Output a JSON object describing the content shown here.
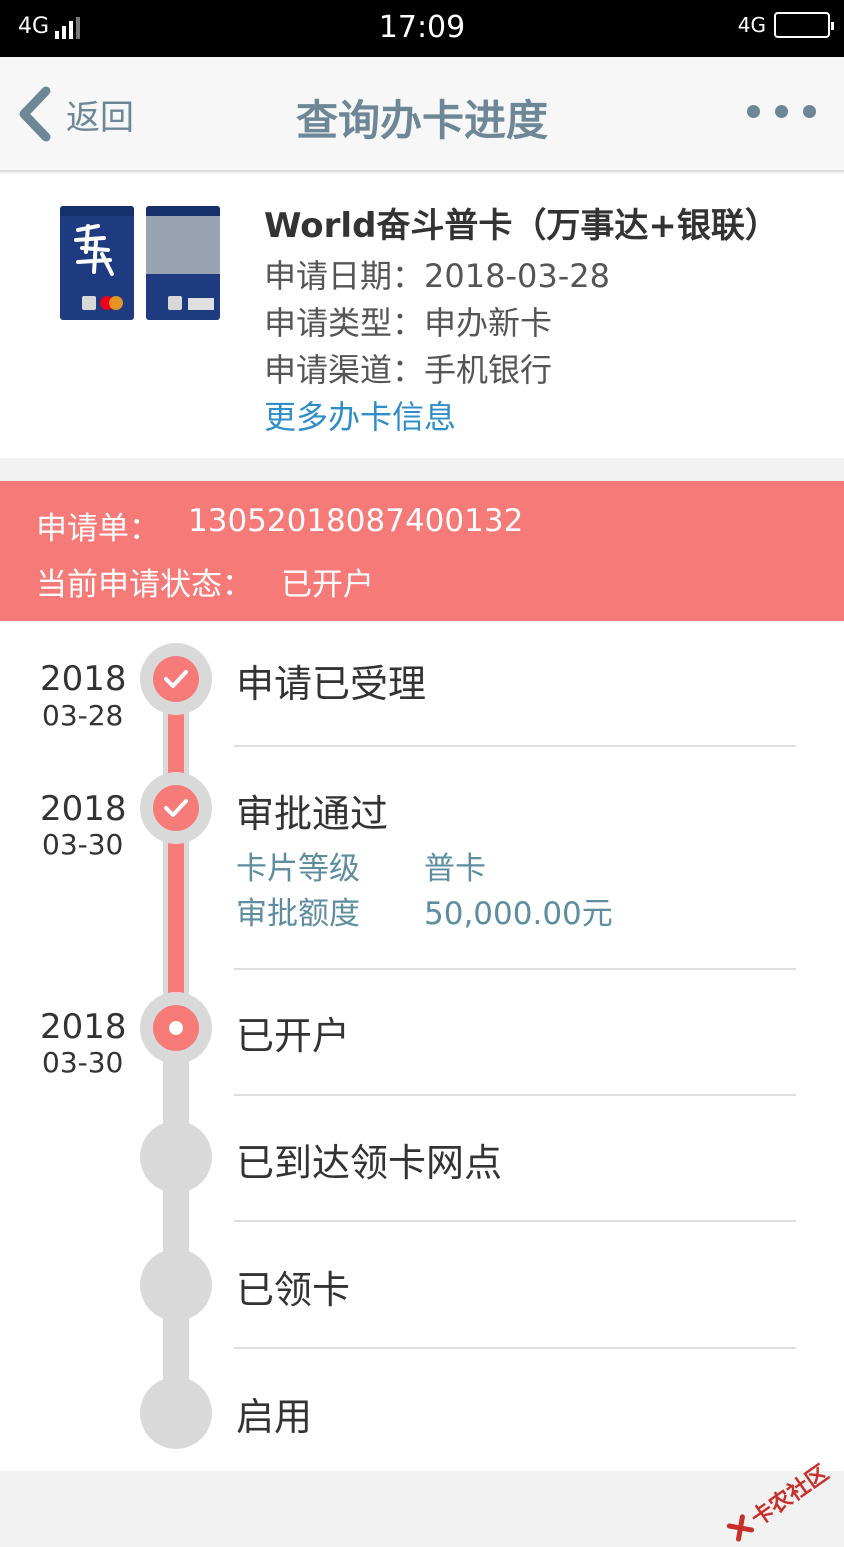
{
  "status_bar": {
    "network_left": "4G",
    "time": "17:09",
    "network_right": "4G"
  },
  "nav": {
    "back_label": "返回",
    "title": "查询办卡进度"
  },
  "card": {
    "name": "World奋斗普卡（万事达+银联）",
    "rows": [
      {
        "label": "申请日期：",
        "value": "2018-03-28"
      },
      {
        "label": "申请类型：",
        "value": "申办新卡"
      },
      {
        "label": "申请渠道：",
        "value": "手机银行"
      }
    ],
    "more_link": "更多办卡信息"
  },
  "banner": {
    "order_label": "申请单：",
    "order_value": "13052018087400132",
    "status_label": "当前申请状态：",
    "status_value": "已开户",
    "color": "#f57a78"
  },
  "timeline": {
    "steps": [
      {
        "year": "2018",
        "date": "03-28",
        "title": "申请已受理",
        "state": "done"
      },
      {
        "year": "2018",
        "date": "03-30",
        "title": "审批通过",
        "state": "done",
        "details": [
          {
            "label": "卡片等级",
            "value": "普卡"
          },
          {
            "label": "审批额度",
            "value": "50,000.00元"
          }
        ]
      },
      {
        "year": "2018",
        "date": "03-30",
        "title": "已开户",
        "state": "current"
      },
      {
        "year": "",
        "date": "",
        "title": "已到达领卡网点",
        "state": "pending"
      },
      {
        "year": "",
        "date": "",
        "title": "已领卡",
        "state": "pending"
      },
      {
        "year": "",
        "date": "",
        "title": "启用",
        "state": "pending"
      }
    ]
  },
  "watermark": "卡农社区"
}
